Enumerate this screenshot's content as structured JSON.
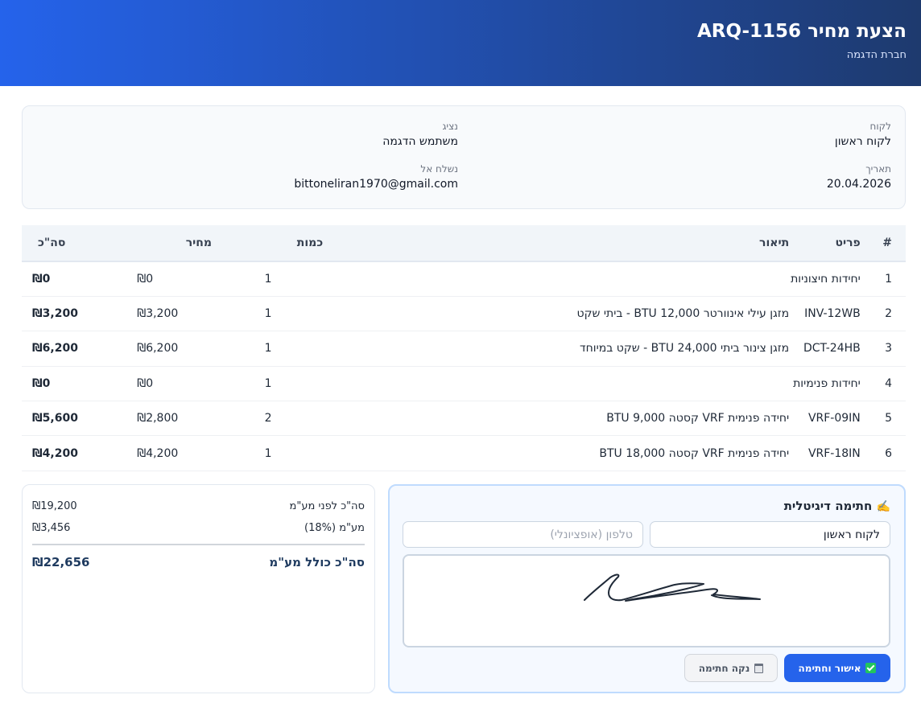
{
  "header": {
    "title": "הצעת מחיר ARQ-1156",
    "company": "חברת הדגמה"
  },
  "info": {
    "customer_label": "לקוח",
    "customer_value": "לקוח ראשון",
    "date_label": "תאריך",
    "date_value": "20.04.2026",
    "rep_label": "נציג",
    "rep_value": "משתמש הדגמה",
    "sent_label": "נשלח אל",
    "sent_value": "bittoneliran1970@gmail.com"
  },
  "table": {
    "headers": [
      "#",
      "פריט",
      "תיאור",
      "כמות",
      "מחיר",
      "סה\"כ"
    ],
    "rows": [
      [
        "1",
        "יחידות חיצוניות",
        "",
        "1",
        "₪0",
        "₪0"
      ],
      [
        "2",
        "INV-12WB",
        "מזגן עילי אינוורטר 12,000 BTU - ביתי שקט",
        "1",
        "₪3,200",
        "₪3,200"
      ],
      [
        "3",
        "DCT-24HB",
        "מזגן צינור ביתי 24,000 BTU - שקט במיוחד",
        "1",
        "₪6,200",
        "₪6,200"
      ],
      [
        "4",
        "יחידות פנימיות",
        "",
        "1",
        "₪0",
        "₪0"
      ],
      [
        "5",
        "VRF-09IN",
        "יחידה פנימית VRF קסטה 9,000 BTU",
        "2",
        "₪2,800",
        "₪5,600"
      ],
      [
        "6",
        "VRF-18IN",
        "יחידה פנימית VRF קסטה 18,000 BTU",
        "1",
        "₪4,200",
        "₪4,200"
      ]
    ]
  },
  "totals": {
    "subtotal_label": "סה\"כ לפני מע\"מ",
    "subtotal_value": "₪19,200",
    "vat_label": "מע\"מ (18%)",
    "vat_value": "₪3,456",
    "grand_label": "סה\"כ כולל מע\"מ",
    "grand_value": "₪22,656"
  },
  "signature": {
    "title": "חתימה דיגיטלית",
    "pen_icon": "✍️",
    "name_value": "לקוח ראשון",
    "phone_placeholder": "טלפון (אופציונלי)",
    "approve_label": "אישור וחתימה",
    "clear_label": "נקה חתימה"
  },
  "colors": {
    "accent": "#2563eb",
    "header_dark": "#1e3a6e"
  }
}
